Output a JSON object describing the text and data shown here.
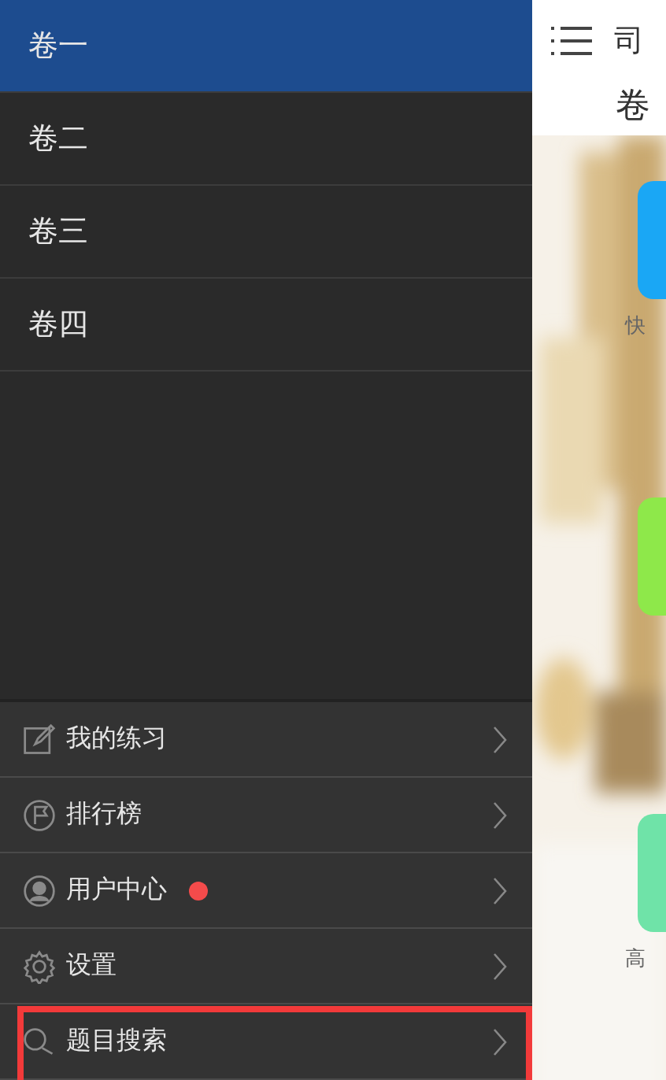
{
  "drawer": {
    "volumes": [
      {
        "label": "卷一",
        "selected": true
      },
      {
        "label": "卷二",
        "selected": false
      },
      {
        "label": "卷三",
        "selected": false
      },
      {
        "label": "卷四",
        "selected": false
      }
    ],
    "menu": [
      {
        "label": "我的练习",
        "badge": false,
        "highlighted": false
      },
      {
        "label": "排行榜",
        "badge": false,
        "highlighted": false
      },
      {
        "label": "用户中心",
        "badge": true,
        "highlighted": false
      },
      {
        "label": "设置",
        "badge": false,
        "highlighted": false
      },
      {
        "label": "题目搜索",
        "badge": false,
        "highlighted": true
      }
    ]
  },
  "main": {
    "title": "司",
    "subtitle": "卷",
    "tiles": [
      {
        "label": "快",
        "color": "#1aa7f5"
      },
      {
        "color": "#8ee84a"
      },
      {
        "label": "高",
        "color": "#6fe3a8"
      }
    ]
  }
}
